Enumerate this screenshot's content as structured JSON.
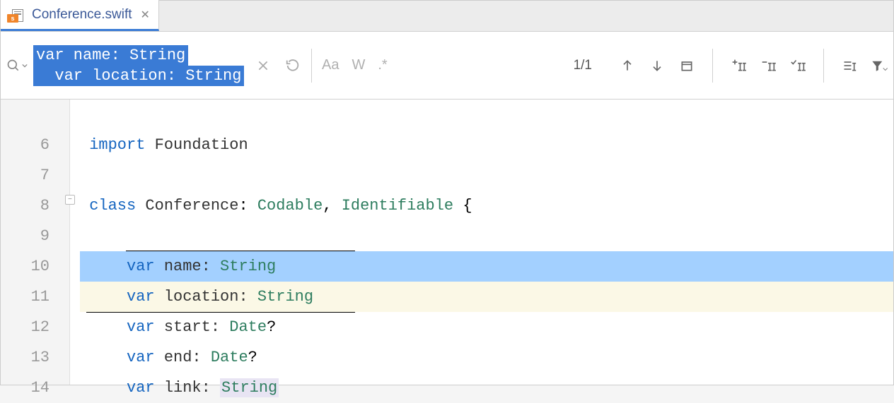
{
  "tab": {
    "filename": "Conference.swift",
    "badge": "s"
  },
  "find": {
    "search_line1": "var name: String",
    "search_line2": "  var location: String",
    "match_count": "1/1",
    "options": {
      "case": "Aa",
      "word": "W",
      "regex": ".*"
    }
  },
  "gutter": {
    "lines": [
      "",
      "6",
      "7",
      "8",
      "9",
      "10",
      "11",
      "12",
      "13",
      "14"
    ]
  },
  "code": {
    "line6": {
      "kw": "import",
      "rest": " Foundation"
    },
    "line8": {
      "kw": "class",
      "ident": " Conference",
      "colon": ": ",
      "type1": "Codable",
      "comma": ", ",
      "type2": "Identifiable",
      "brace": " {"
    },
    "line10": {
      "indent": "    ",
      "kw": "var",
      "ident": " name: ",
      "type": "String"
    },
    "line11": {
      "indent": "    ",
      "kw": "var",
      "ident": " location: ",
      "type": "String"
    },
    "line12": {
      "indent": "    ",
      "kw": "var",
      "ident": " start: ",
      "type": "Date",
      "opt": "?"
    },
    "line13": {
      "indent": "    ",
      "kw": "var",
      "ident": " end: ",
      "type": "Date",
      "opt": "?"
    },
    "line14": {
      "indent": "    ",
      "kw": "var",
      "ident": " link: ",
      "type": "String"
    }
  }
}
